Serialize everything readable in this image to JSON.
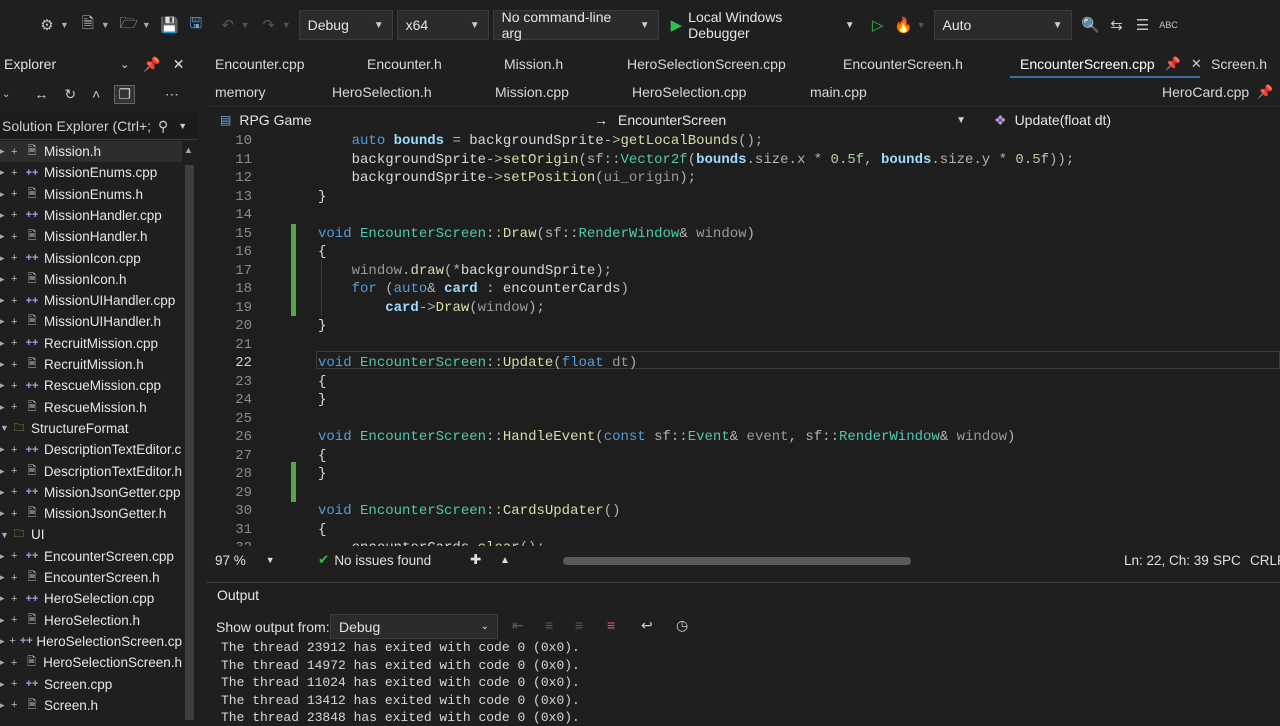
{
  "toolbar": {
    "config": "Debug",
    "platform": "x64",
    "cmdline": "No command-line arg",
    "debugger": "Local Windows Debugger",
    "auto": "Auto"
  },
  "solution_explorer": {
    "title": "Explorer",
    "search_placeholder": "Solution Explorer (Ctrl+;",
    "items": [
      {
        "label": "Mission.h",
        "kind": "h"
      },
      {
        "label": "MissionEnums.cpp",
        "kind": "cpp"
      },
      {
        "label": "MissionEnums.h",
        "kind": "h"
      },
      {
        "label": "MissionHandler.cpp",
        "kind": "cpp"
      },
      {
        "label": "MissionHandler.h",
        "kind": "h"
      },
      {
        "label": "MissionIcon.cpp",
        "kind": "cpp"
      },
      {
        "label": "MissionIcon.h",
        "kind": "h"
      },
      {
        "label": "MissionUIHandler.cpp",
        "kind": "cpp"
      },
      {
        "label": "MissionUIHandler.h",
        "kind": "h"
      },
      {
        "label": "RecruitMission.cpp",
        "kind": "cpp"
      },
      {
        "label": "RecruitMission.h",
        "kind": "h"
      },
      {
        "label": "RescueMission.cpp",
        "kind": "cpp"
      },
      {
        "label": "RescueMission.h",
        "kind": "h"
      },
      {
        "label": "StructureFormat",
        "kind": "folder"
      },
      {
        "label": "DescriptionTextEditor.c",
        "kind": "cpp"
      },
      {
        "label": "DescriptionTextEditor.h",
        "kind": "h"
      },
      {
        "label": "MissionJsonGetter.cpp",
        "kind": "cpp"
      },
      {
        "label": "MissionJsonGetter.h",
        "kind": "h"
      },
      {
        "label": "UI",
        "kind": "folder"
      },
      {
        "label": "EncounterScreen.cpp",
        "kind": "cpp"
      },
      {
        "label": "EncounterScreen.h",
        "kind": "h"
      },
      {
        "label": "HeroSelection.cpp",
        "kind": "cpp"
      },
      {
        "label": "HeroSelection.h",
        "kind": "h"
      },
      {
        "label": "HeroSelectionScreen.cp",
        "kind": "cpp"
      },
      {
        "label": "HeroSelectionScreen.h",
        "kind": "h"
      },
      {
        "label": "Screen.cpp",
        "kind": "cpp"
      },
      {
        "label": "Screen.h",
        "kind": "h"
      }
    ]
  },
  "tabs_row1": [
    "Encounter.cpp",
    "Encounter.h",
    "Mission.h",
    "HeroSelectionScreen.cpp",
    "EncounterScreen.h",
    "EncounterScreen.cpp",
    "Screen.h"
  ],
  "tabs_row2": [
    "memory",
    "HeroSelection.h",
    "Mission.cpp",
    "HeroSelection.cpp",
    "main.cpp",
    "HeroCard.cpp"
  ],
  "navbar": {
    "project": "RPG Game",
    "scope": "EncounterScreen",
    "member": "Update(float dt)"
  },
  "editor": {
    "line_numbers": [
      "10",
      "11",
      "12",
      "13",
      "14",
      "15",
      "16",
      "17",
      "18",
      "19",
      "20",
      "21",
      "22",
      "23",
      "24",
      "25",
      "26",
      "27",
      "28",
      "29",
      "30",
      "31",
      "32"
    ],
    "code": {
      "l10_auto": "auto",
      "l10_bounds": "bounds",
      "l10_eq": " = ",
      "l10_bg": "backgroundSprite",
      "l10_arrow": "->",
      "l10_fn": "getLocalBounds",
      "l10_tail": "();",
      "l11_bg": "backgroundSprite",
      "l11_arrow": "->",
      "l11_fn": "setOrigin",
      "l11_sf": "(sf::",
      "l11_ty": "Vector2f",
      "l11_p1": "(",
      "l11_b1": "bounds",
      "l11_m1": ".size.x * ",
      "l11_n1": "0.5f",
      "l11_c": ", ",
      "l11_b2": "bounds",
      "l11_m2": ".size.y * ",
      "l11_n2": "0.5f",
      "l11_tail": "));",
      "l12_bg": "backgroundSprite",
      "l12_arrow": "->",
      "l12_fn": "setPosition",
      "l12_p": "(",
      "l12_arg": "ui_origin",
      "l12_tail": ");",
      "l13": "}",
      "l15_void": "void",
      "l15_cls": "EncounterScreen",
      "l15_sep": "::",
      "l15_fn": "Draw",
      "l15_sf": "(sf::",
      "l15_ty": "RenderWindow",
      "l15_amp": "& ",
      "l15_prm": "window",
      "l15_tail": ")",
      "l16": "{",
      "l17_win": "window",
      "l17_dot": ".",
      "l17_fn": "draw",
      "l17_p": "(*",
      "l17_bg": "backgroundSprite",
      "l17_tail": ");",
      "l18_for": "for",
      "l18_p": " (",
      "l18_auto": "auto",
      "l18_amp": "& ",
      "l18_card": "card",
      "l18_colon": " : ",
      "l18_cards": "encounterCards",
      "l18_tail": ")",
      "l19_card": "card",
      "l19_arrow": "->",
      "l19_fn": "Draw",
      "l19_p": "(",
      "l19_win": "window",
      "l19_tail": ");",
      "l20": "}",
      "l22_void": "void",
      "l22_cls": "EncounterScreen",
      "l22_sep": "::",
      "l22_fn": "Update",
      "l22_p": "(",
      "l22_float": "float",
      "l22_dt": " dt",
      "l22_tail": ")",
      "l23": "{",
      "l24": "}",
      "l26_void": "void",
      "l26_cls": "EncounterScreen",
      "l26_sep": "::",
      "l26_fn": "HandleEvent",
      "l26_p": "(",
      "l26_const": "const",
      "l26_sf": " sf::",
      "l26_ev": "Event",
      "l26_amp": "& ",
      "l26_evp": "event",
      "l26_c": ", sf::",
      "l26_rw": "RenderWindow",
      "l26_amp2": "& ",
      "l26_win": "window",
      "l26_tail": ")",
      "l27": "{",
      "l28": "}",
      "l30_void": "void",
      "l30_cls": "EncounterScreen",
      "l30_sep": "::",
      "l30_fn": "CardsUpdater",
      "l30_tail": "()",
      "l31": "{",
      "l32_cards": "encounterCards",
      "l32_dot": ".",
      "l32_fn": "clear",
      "l32_tail": "();"
    }
  },
  "editor_status": {
    "zoom": "97 %",
    "issues": "No issues found",
    "position": "Ln: 22, Ch: 39",
    "spacing": "SPC",
    "eol": "CRLF"
  },
  "output": {
    "title": "Output",
    "show_from_label": "Show output from:",
    "source": "Debug",
    "lines": [
      "The thread 23912 has exited with code 0 (0x0).",
      "The thread 14972 has exited with code 0 (0x0).",
      "The thread 11024 has exited with code 0 (0x0).",
      "The thread 13412 has exited with code 0 (0x0).",
      "The thread 23848 has exited with code 0 (0x0)."
    ]
  }
}
